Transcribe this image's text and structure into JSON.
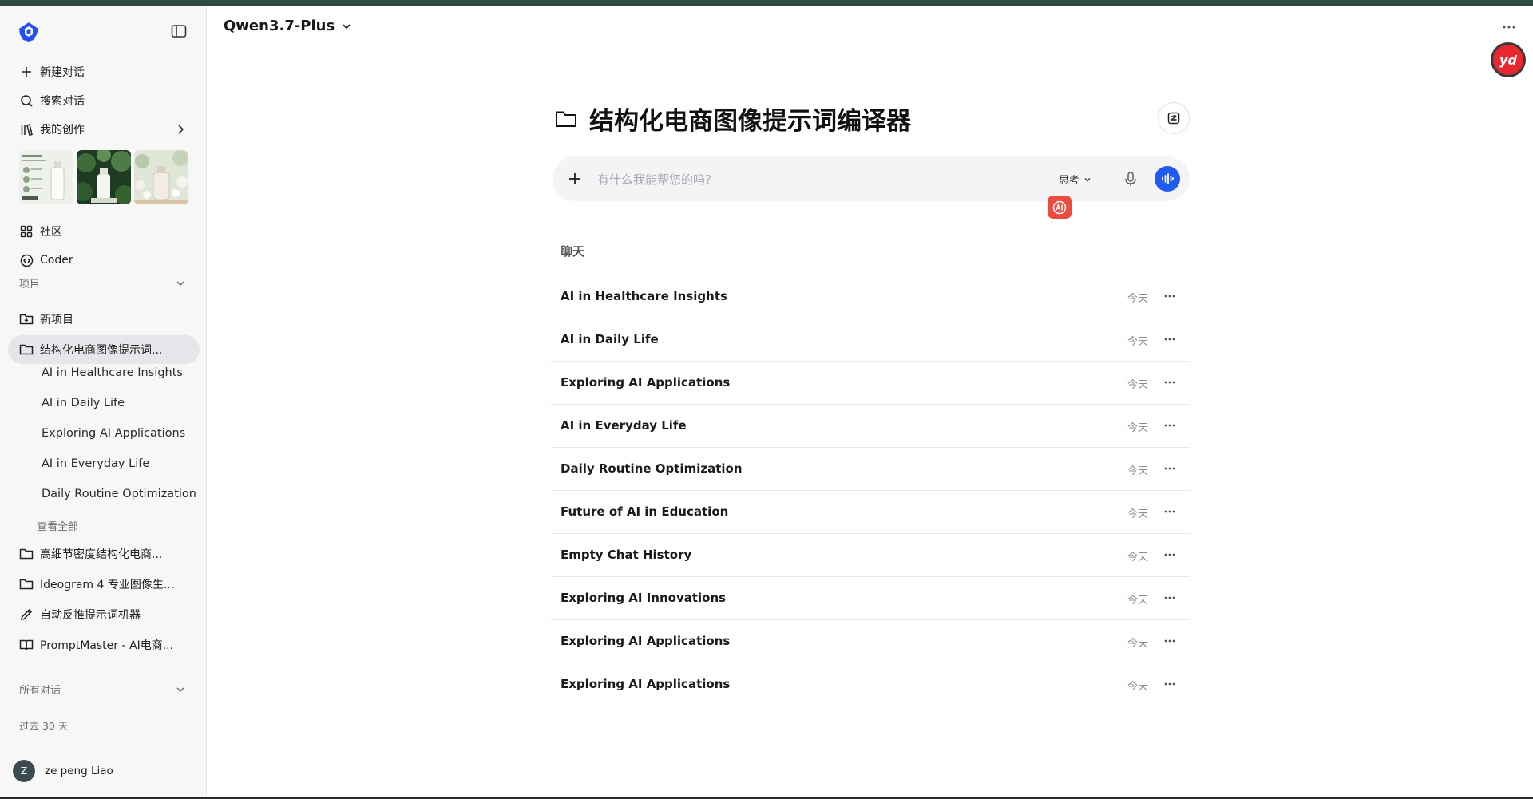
{
  "app": {
    "model_name": "Qwen3.7-Plus",
    "brand_color": "#1f5bf0",
    "badge_text": "yd"
  },
  "sidebar": {
    "new_chat": "新建对话",
    "search_chat": "搜索对话",
    "my_creations": "我的创作",
    "community": "社区",
    "coder": "Coder",
    "projects_label": "项目",
    "new_project": "新项目",
    "active_project": "结构化电商图像提示词...",
    "project_chats": [
      "AI in Healthcare Insights",
      "AI in Daily Life",
      "Exploring AI Applications",
      "AI in Everyday Life",
      "Daily Routine Optimization"
    ],
    "view_all": "查看全部",
    "other_projects": [
      {
        "label": "高细节密度结构化电商...",
        "icon": "folder-icon"
      },
      {
        "label": "Ideogram 4 专业图像生...",
        "icon": "folder-icon"
      },
      {
        "label": "自动反推提示词机器",
        "icon": "pen-icon"
      },
      {
        "label": "PromptMaster - AI电商...",
        "icon": "book-icon"
      }
    ],
    "all_chats_label": "所有对话",
    "past_30_days": "过去 30 天",
    "user": {
      "initial": "Z",
      "name": "ze peng Liao"
    }
  },
  "main": {
    "project_title": "结构化电商图像提示词编译器",
    "input_placeholder": "有什么我能帮您的吗?",
    "think_label": "思考",
    "chat_section_label": "聊天",
    "chats": [
      {
        "title": "AI in Healthcare Insights",
        "date": "今天"
      },
      {
        "title": "AI in Daily Life",
        "date": "今天"
      },
      {
        "title": "Exploring AI Applications",
        "date": "今天"
      },
      {
        "title": "AI in Everyday Life",
        "date": "今天"
      },
      {
        "title": "Daily Routine Optimization",
        "date": "今天"
      },
      {
        "title": "Future of AI in Education",
        "date": "今天"
      },
      {
        "title": "Empty Chat History",
        "date": "今天"
      },
      {
        "title": "Exploring AI Innovations",
        "date": "今天"
      },
      {
        "title": "Exploring AI Applications",
        "date": "今天"
      },
      {
        "title": "Exploring AI Applications",
        "date": "今天"
      }
    ]
  }
}
